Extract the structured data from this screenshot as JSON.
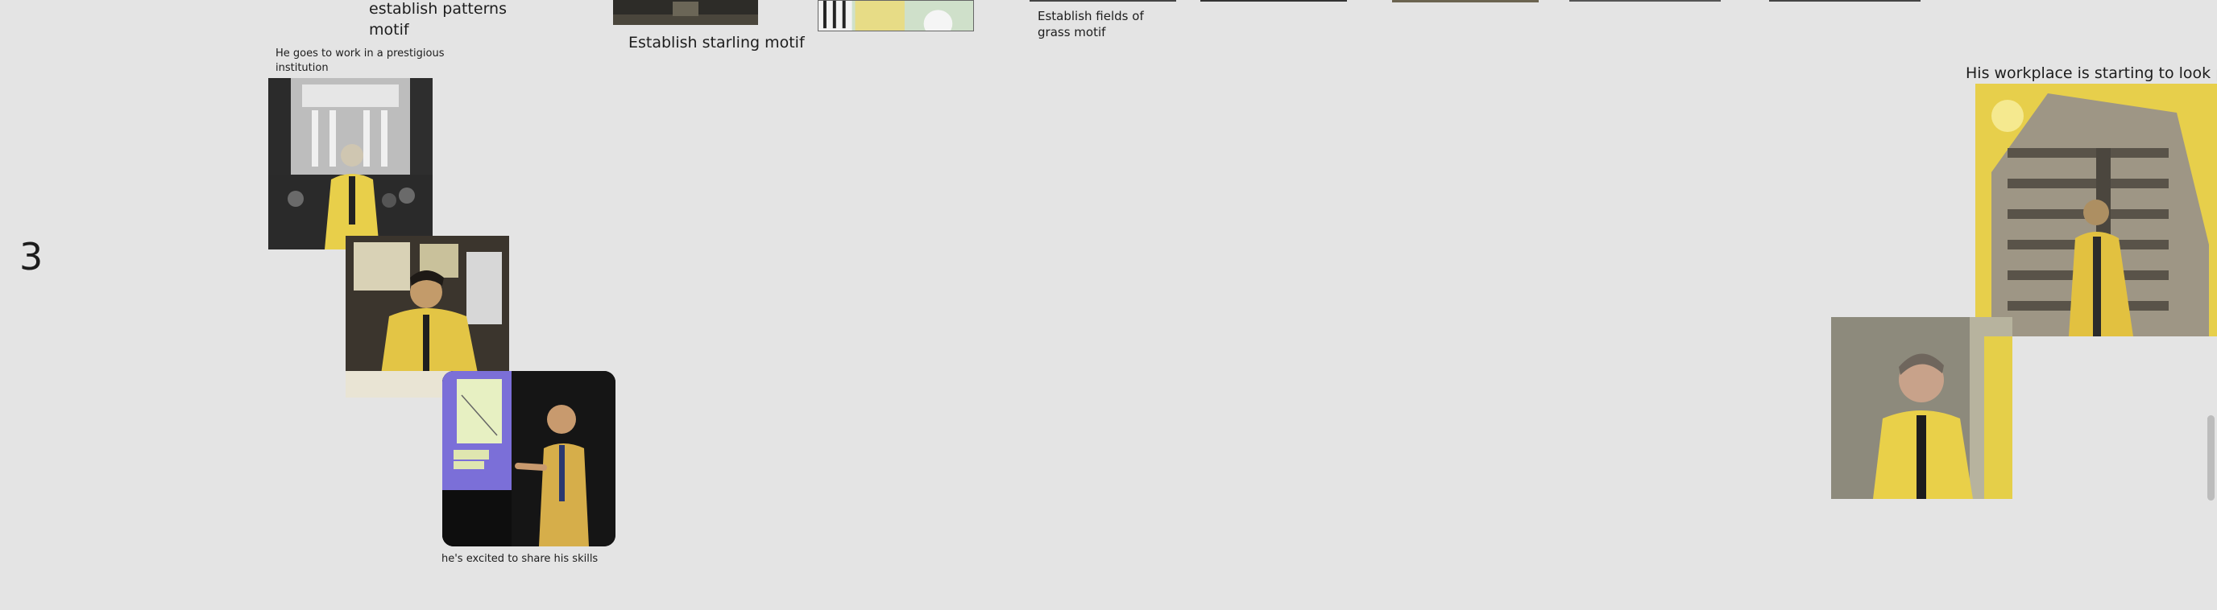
{
  "board": {
    "row_number": "3",
    "top_labels": {
      "patterns": "establish patterns motif",
      "starling": "Establish starling motif",
      "grass": "Establish fields of grass motif"
    },
    "captions": {
      "institution": "He goes to work in a prestigious institution",
      "skills": "he's excited to share his skills",
      "prison": "His workplace is starting to look prision like"
    }
  },
  "colors": {
    "background": "#e4e4e4",
    "accent_yellow": "#e7cf4b",
    "slide_purple": "#7b6fd8"
  }
}
